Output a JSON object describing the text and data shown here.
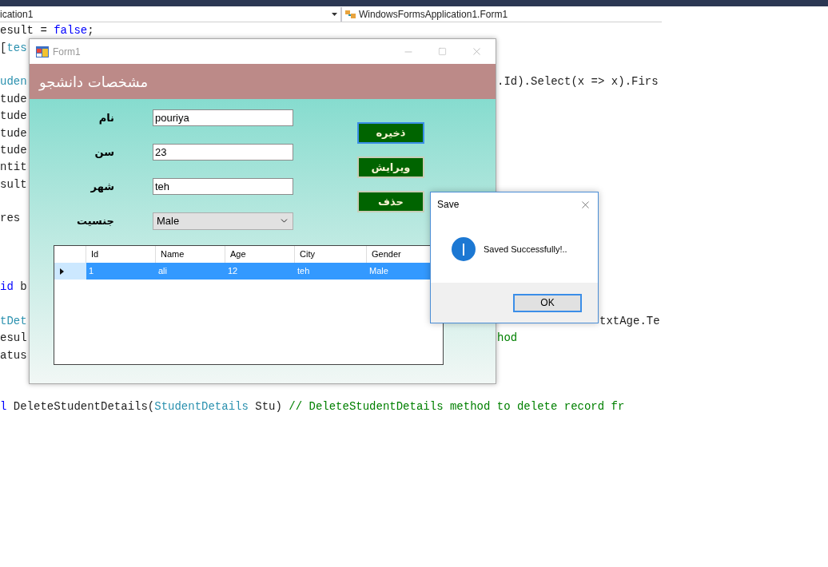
{
  "toolbar": {
    "project": "ication1",
    "class": "WindowsFormsApplication1.Form1"
  },
  "code_lines": [
    {
      "kind": "code",
      "left": [
        {
          "text": "esult = ",
          "kind": "plain"
        },
        {
          "text": "false",
          "kind": "keyword"
        },
        {
          "text": ";",
          "kind": "plain"
        }
      ]
    },
    {
      "kind": "code",
      "left": [
        {
          "text": "[",
          "kind": "plain"
        },
        {
          "text": "tes",
          "kind": "type"
        }
      ]
    },
    {
      "kind": "blank"
    },
    {
      "kind": "code",
      "left": [
        {
          "text": "uden",
          "kind": "type"
        }
      ],
      "right": {
        "kind": "form",
        "segments": [
          {
            "text": ".Id).Select(x => x).Firs",
            "kind": "plain"
          }
        ]
      }
    },
    {
      "kind": "code",
      "left": [
        {
          "text": "tude",
          "kind": "plain"
        }
      ]
    },
    {
      "kind": "code",
      "left": [
        {
          "text": "tude",
          "kind": "plain"
        }
      ]
    },
    {
      "kind": "code",
      "left": [
        {
          "text": "tude",
          "kind": "plain"
        }
      ]
    },
    {
      "kind": "code",
      "left": [
        {
          "text": "tude",
          "kind": "plain"
        }
      ]
    },
    {
      "kind": "code",
      "left": [
        {
          "text": "ntit",
          "kind": "plain"
        }
      ]
    },
    {
      "kind": "code",
      "left": [
        {
          "text": "sult",
          "kind": "plain"
        }
      ]
    },
    {
      "kind": "blank"
    },
    {
      "kind": "code",
      "left": [
        {
          "text": "res",
          "kind": "plain"
        }
      ]
    },
    {
      "kind": "blank"
    },
    {
      "kind": "blank"
    },
    {
      "kind": "blank"
    },
    {
      "kind": "code",
      "left": [
        {
          "text": "id",
          "kind": "keyword"
        },
        {
          "text": " b",
          "kind": "plain"
        }
      ]
    },
    {
      "kind": "blank"
    },
    {
      "kind": "code",
      "left": [
        {
          "text": "tDet",
          "kind": "type"
        }
      ],
      "right": {
        "kind": "dialog",
        "segments": [
          {
            "text": "txtAge.Te",
            "kind": "plain"
          }
        ]
      }
    },
    {
      "kind": "code",
      "left": [
        {
          "text": "esul",
          "kind": "plain"
        }
      ],
      "right": {
        "kind": "form",
        "segments": [
          {
            "text": "hod",
            "kind": "comment"
          }
        ]
      }
    },
    {
      "kind": "code",
      "left": [
        {
          "text": "atus",
          "kind": "plain"
        }
      ]
    },
    {
      "kind": "blank"
    },
    {
      "kind": "blank"
    },
    {
      "kind": "code",
      "left": [
        {
          "text": "l",
          "kind": "keyword"
        },
        {
          "text": " DeleteStudentDetails(",
          "kind": "plain"
        },
        {
          "text": "StudentDetails",
          "kind": "type"
        },
        {
          "text": " Stu) ",
          "kind": "plain"
        },
        {
          "text": "// DeleteStudentDetails method to delete record fr",
          "kind": "comment"
        }
      ]
    }
  ],
  "form": {
    "title": "Form1",
    "header": "مشخصات دانشجو",
    "fields": [
      {
        "label": "نام",
        "value": "pouriya",
        "kind": "text"
      },
      {
        "label": "سن",
        "value": "23",
        "kind": "text"
      },
      {
        "label": "شهر",
        "value": "teh",
        "kind": "text"
      },
      {
        "label": "جنسیت",
        "value": "Male",
        "kind": "dropdown"
      }
    ],
    "buttons": [
      {
        "label": "ذخیره",
        "focused": true
      },
      {
        "label": "ویرایش",
        "focused": false
      },
      {
        "label": "حذف",
        "focused": false
      }
    ],
    "grid": {
      "columns": [
        "Id",
        "Name",
        "Age",
        "City",
        "Gender"
      ],
      "rows": [
        {
          "selected": true,
          "cells": [
            "1",
            "ali",
            "12",
            "teh",
            "Male"
          ]
        }
      ]
    }
  },
  "dialog": {
    "title": "Save",
    "message": "Saved Successfully!..",
    "button": "OK"
  }
}
